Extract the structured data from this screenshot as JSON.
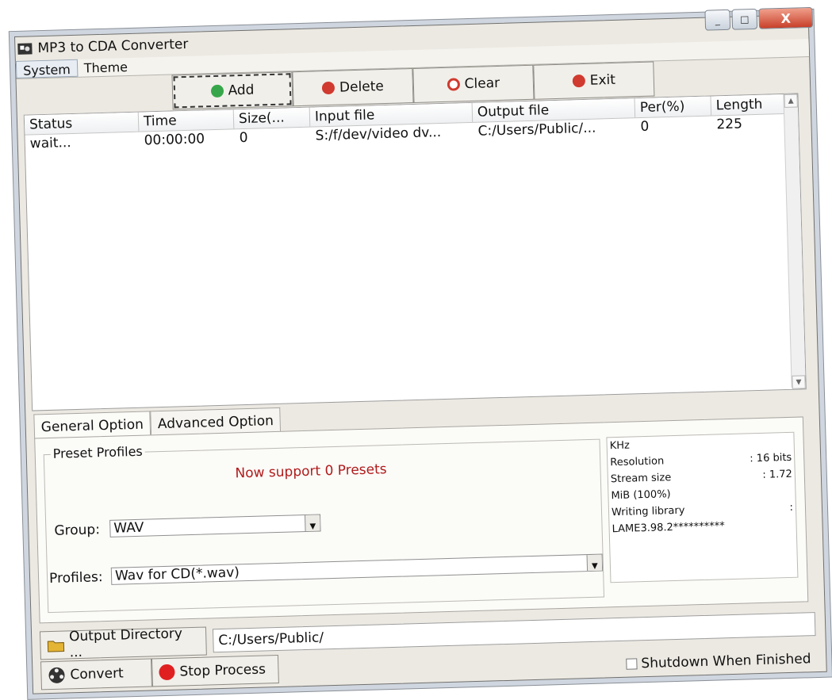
{
  "window": {
    "title": "MP3 to CDA Converter",
    "caption_buttons": [
      "_",
      "□",
      "X"
    ]
  },
  "menu": [
    "System",
    "Theme"
  ],
  "toolbar": {
    "add": "Add",
    "delete": "Delete",
    "clear": "Clear",
    "exit": "Exit"
  },
  "table": {
    "headers": [
      "Status",
      "Time",
      "Size(...",
      "Input file",
      "Output file",
      "Per(%)",
      "Length"
    ],
    "rows": [
      [
        "wait...",
        "00:00:00",
        "0",
        "S:/f/dev/video dv...",
        "C:/Users/Public/...",
        "0",
        "225"
      ]
    ]
  },
  "tabs": [
    "General Option",
    "Advanced Option"
  ],
  "preset": {
    "legend": "Preset Profiles",
    "message": "Now support 0 Presets",
    "group_label": "Group:",
    "group_value": "WAV",
    "profiles_label": "Profiles:",
    "profiles_value": "Wav for CD(*.wav)"
  },
  "info": {
    "lines": [
      {
        "left": "KHz",
        "right": ""
      },
      {
        "left": "Resolution",
        "right": ": 16 bits"
      },
      {
        "left": "Stream size",
        "right": ": 1.72"
      },
      {
        "left": "MiB (100%)",
        "right": ""
      },
      {
        "left": "Writing library",
        "right": ":"
      },
      {
        "left": "LAME3.98.2**********",
        "right": ""
      }
    ]
  },
  "output": {
    "dir_button": "Output Directory ...",
    "dir_value": "C:/Users/Public/",
    "convert": "Convert",
    "stop": "Stop Process",
    "shutdown_label": "Shutdown When Finished"
  },
  "colors": {
    "window_bg": "#ece9e2",
    "preset_msg": "#b01c1c",
    "add_icon": "#37a64a",
    "delete_icon": "#d03a2f",
    "stop_icon": "#e02020"
  }
}
